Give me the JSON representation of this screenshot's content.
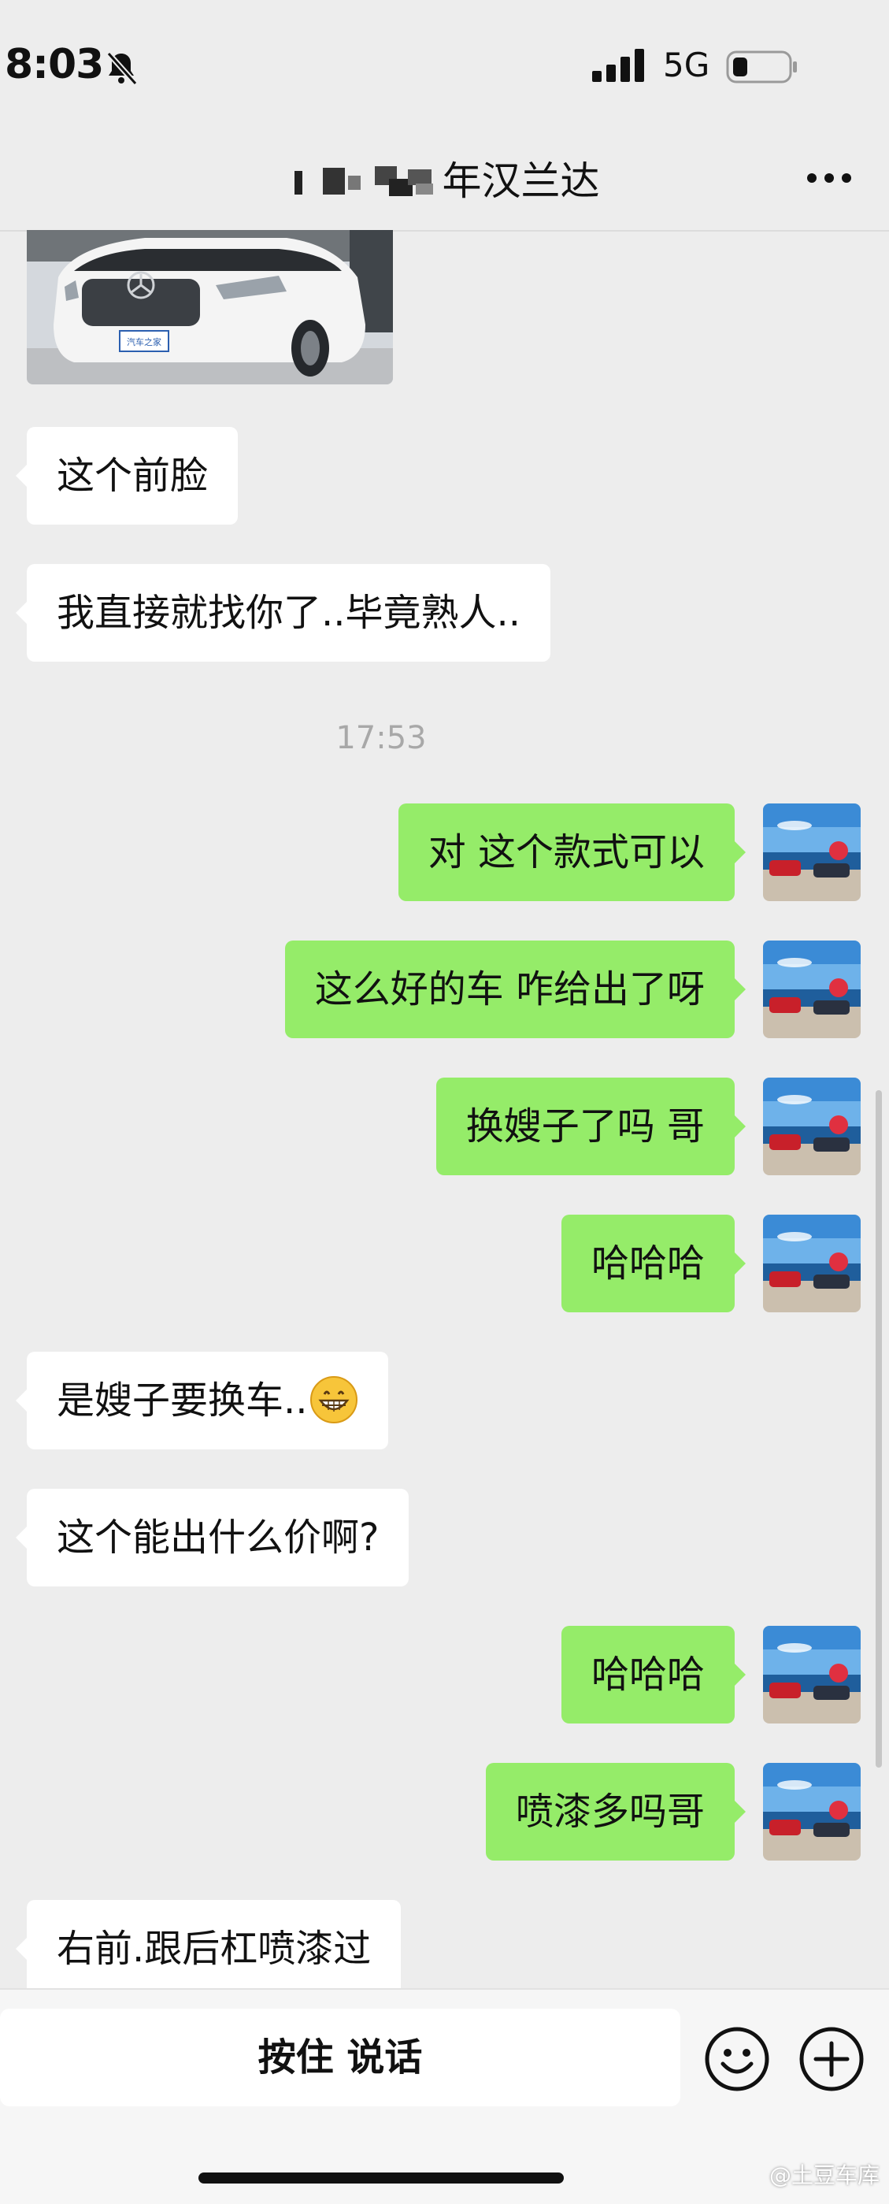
{
  "status": {
    "time": "8:03",
    "network": "5G"
  },
  "nav": {
    "title_suffix": "年汉兰达"
  },
  "messages": [
    {
      "side": "left",
      "text": "这个前脸"
    },
    {
      "side": "left",
      "text": "我直接就找你了..毕竟熟人.."
    },
    {
      "side": "time",
      "text": "17:53"
    },
    {
      "side": "right",
      "text": "对 这个款式可以"
    },
    {
      "side": "right",
      "text": "这么好的车 咋给出了呀"
    },
    {
      "side": "right",
      "text": "换嫂子了吗 哥"
    },
    {
      "side": "right",
      "text": "哈哈哈"
    },
    {
      "side": "left",
      "text": "是嫂子要换车.."
    },
    {
      "side": "left",
      "text": "这个能出什么价啊?"
    },
    {
      "side": "right",
      "text": "哈哈哈"
    },
    {
      "side": "right",
      "text": "喷漆多吗哥"
    },
    {
      "side": "left",
      "text": "右前.跟后杠喷漆过"
    }
  ],
  "photo": {
    "plate_text": "汽车之家"
  },
  "input": {
    "hold_to_talk": "按住 说话"
  },
  "watermark": "@土豆车库",
  "icons": [
    "bell-slash-icon",
    "signal-icon",
    "battery-icon",
    "more-icon",
    "emoji-face-icon",
    "plus-icon",
    "grin-emoji-icon"
  ],
  "colors": {
    "background": "#ededed",
    "self_bubble": "#95ec69",
    "other_bubble": "#ffffff"
  }
}
